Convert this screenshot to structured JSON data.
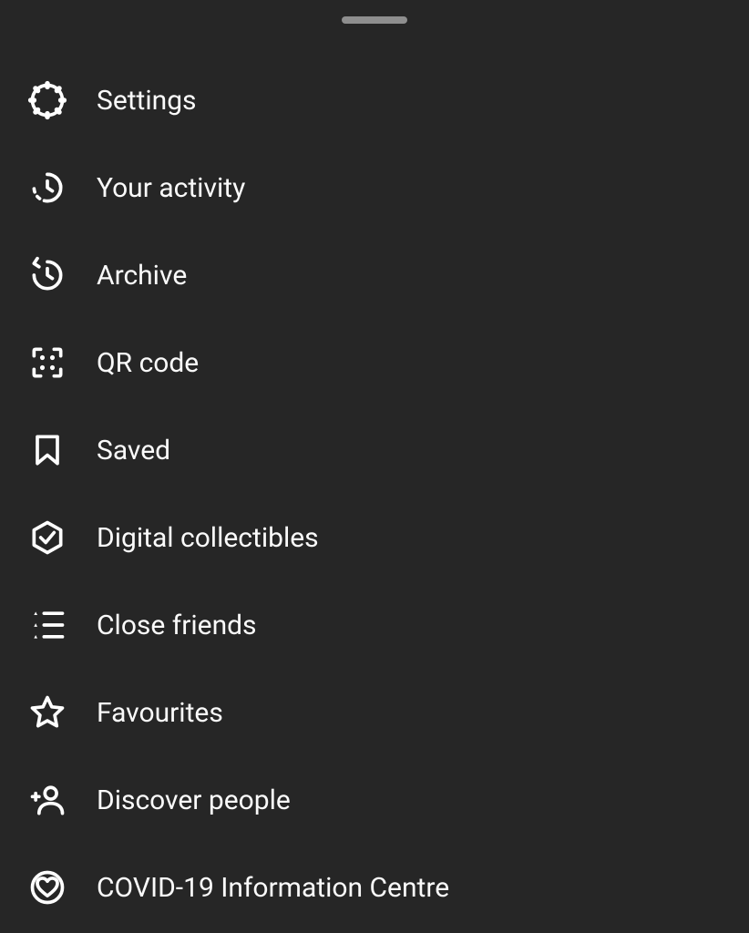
{
  "menu": {
    "items": [
      {
        "label": "Settings",
        "icon": "settings-icon"
      },
      {
        "label": "Your activity",
        "icon": "activity-icon"
      },
      {
        "label": "Archive",
        "icon": "archive-icon"
      },
      {
        "label": "QR code",
        "icon": "qrcode-icon"
      },
      {
        "label": "Saved",
        "icon": "saved-icon"
      },
      {
        "label": "Digital collectibles",
        "icon": "collectibles-icon"
      },
      {
        "label": "Close friends",
        "icon": "close-friends-icon"
      },
      {
        "label": "Favourites",
        "icon": "favourites-icon"
      },
      {
        "label": "Discover people",
        "icon": "discover-people-icon"
      },
      {
        "label": "COVID-19 Information Centre",
        "icon": "covid-info-icon"
      }
    ]
  }
}
